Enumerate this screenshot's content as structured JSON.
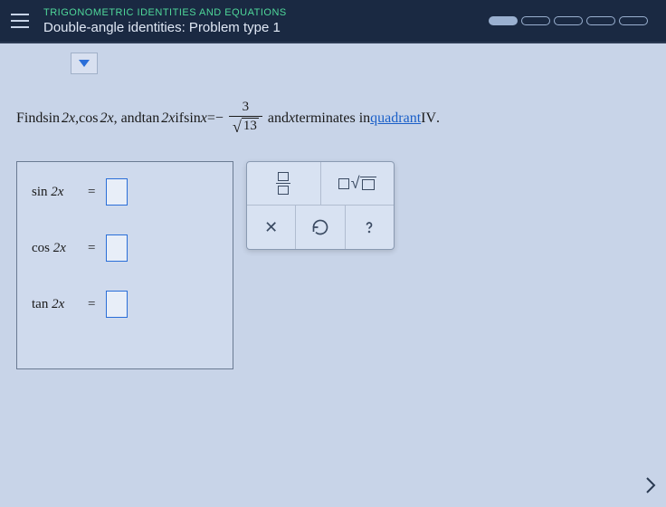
{
  "header": {
    "breadcrumb": "TRIGONOMETRIC IDENTITIES AND EQUATIONS",
    "title": "Double-angle identities: Problem type 1"
  },
  "problem": {
    "lead": "Find ",
    "f1": "sin",
    "arg1": "2x",
    "sep": ", ",
    "f2": "cos",
    "arg2": "2x",
    "and1": ", and ",
    "f3": "tan",
    "arg3": "2x",
    "iftext": " if ",
    "given_fn": "sin",
    "given_var": "x",
    "eq": " = ",
    "neg": "−",
    "num": "3",
    "den_rad": "13",
    "and2": " and ",
    "xvar": "x",
    "terminates": " terminates in ",
    "quadrant_word": "quadrant",
    "quadrant_num": " IV",
    "period": "."
  },
  "answers": {
    "r1_fn": "sin",
    "r1_arg": "2x",
    "r2_fn": "cos",
    "r2_arg": "2x",
    "r3_fn": "tan",
    "r3_arg": "2x",
    "eq": "="
  }
}
